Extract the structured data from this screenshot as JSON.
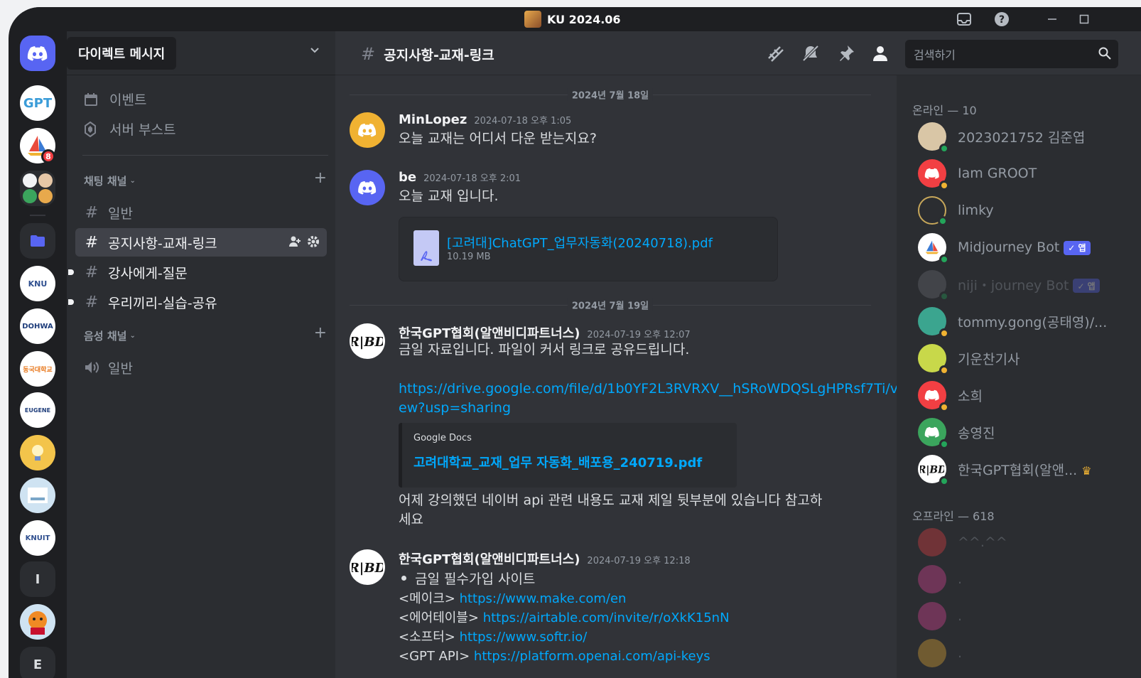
{
  "window": {
    "title": "KU 2024.06"
  },
  "servers": {
    "home_badge": "",
    "gpt_label": "GPT",
    "sailboat_badge": "8",
    "knu_label": "KNU",
    "dohwa_label": "DOHWA",
    "dongguk_label": "동국대학교",
    "eugene_label": "EUGENE",
    "knuit_label": "KNUIT",
    "i_label": "I",
    "e_label": "E"
  },
  "sidebar": {
    "dm_label": "다이렉트 메시지",
    "items": [
      {
        "label": "이벤트",
        "icon": "calendar-icon"
      },
      {
        "label": "서버 부스트",
        "icon": "boost-icon"
      }
    ],
    "text_category": "채팅 채널",
    "text_channels": [
      {
        "label": "일반",
        "active": false,
        "unread": false
      },
      {
        "label": "공지사항-교재-링크",
        "active": true,
        "unread": false
      },
      {
        "label": "강사에게-질문",
        "active": false,
        "unread": true
      },
      {
        "label": "우리끼리-실습-공유",
        "active": false,
        "unread": true
      }
    ],
    "voice_category": "음성 채널",
    "voice_channels": [
      {
        "label": "일반"
      }
    ]
  },
  "header": {
    "channel": "공지사항-교재-링크",
    "search_placeholder": "검색하기"
  },
  "messages": {
    "date1": "2024년 7월 18일",
    "date2": "2024년 7월 19일",
    "m1": {
      "author": "MinLopez",
      "time": "2024-07-18 오후 1:05",
      "text": "오늘 교재는 어디서 다운 받는지요?"
    },
    "m2": {
      "author": "be",
      "time": "2024-07-18 오후 2:01",
      "text": "오늘 교재 입니다.",
      "file_name": "[고려대]ChatGPT_업무자동화(20240718).pdf",
      "file_size": "10.19 MB"
    },
    "m3": {
      "author": "한국GPT협회(알앤비디파트너스)",
      "time": "2024-07-19 오후 12:07",
      "text": "금일 자료입니다. 파일이 커서 링크로 공유드립니다.",
      "link_line1": "https://drive.google.com/file/d/1b0YF2L3RVRXV__hSRoWDQSLgHPRsf7Ti/vi",
      "link_line2": "ew?usp=sharing",
      "embed_provider": "Google Docs",
      "embed_title": "고려대학교_교재_업무 자동화_배포용_240719.pdf",
      "followup_line1": "어제 강의했던 네이버 api 관련 내용도 교재 제일 뒷부분에 있습니다 참고하",
      "followup_line2": "세요"
    },
    "m4": {
      "author": "한국GPT협회(알앤비디파트너스)",
      "time": "2024-07-19 오후 12:18",
      "bullet": "금일 필수가입 사이트",
      "links": [
        {
          "label": "<메이크>",
          "url": "https://www.make.com/en"
        },
        {
          "label": "<에어테이블>",
          "url": "https://airtable.com/invite/r/oXkK15nN"
        },
        {
          "label": "<소프터>",
          "url": "https://www.softr.io/"
        },
        {
          "label": "<GPT API>",
          "url": "https://platform.openai.com/api-keys"
        }
      ]
    }
  },
  "members": {
    "online_header": "온라인 — 10",
    "offline_header": "오프라인 — 618",
    "online": [
      {
        "name": "2023021752 김준엽",
        "status": "online"
      },
      {
        "name": "Iam GROOT",
        "status": "idle"
      },
      {
        "name": "limky",
        "status": "online"
      },
      {
        "name": "Midjourney Bot",
        "status": "online",
        "tag": "✓ 앱"
      },
      {
        "name": "niji・journey Bot",
        "status": "online",
        "tag": "✓ 앱"
      },
      {
        "name": "tommy.gong(공태영)/...",
        "status": "idle"
      },
      {
        "name": "기운찬기사",
        "status": "idle"
      },
      {
        "name": "소희",
        "status": "idle"
      },
      {
        "name": "송영진",
        "status": "online"
      },
      {
        "name": "한국GPT협회(알앤...",
        "status": "online"
      }
    ],
    "offline": [
      {
        "name": "^^.^^"
      },
      {
        "name": "."
      },
      {
        "name": "."
      },
      {
        "name": "."
      }
    ]
  }
}
